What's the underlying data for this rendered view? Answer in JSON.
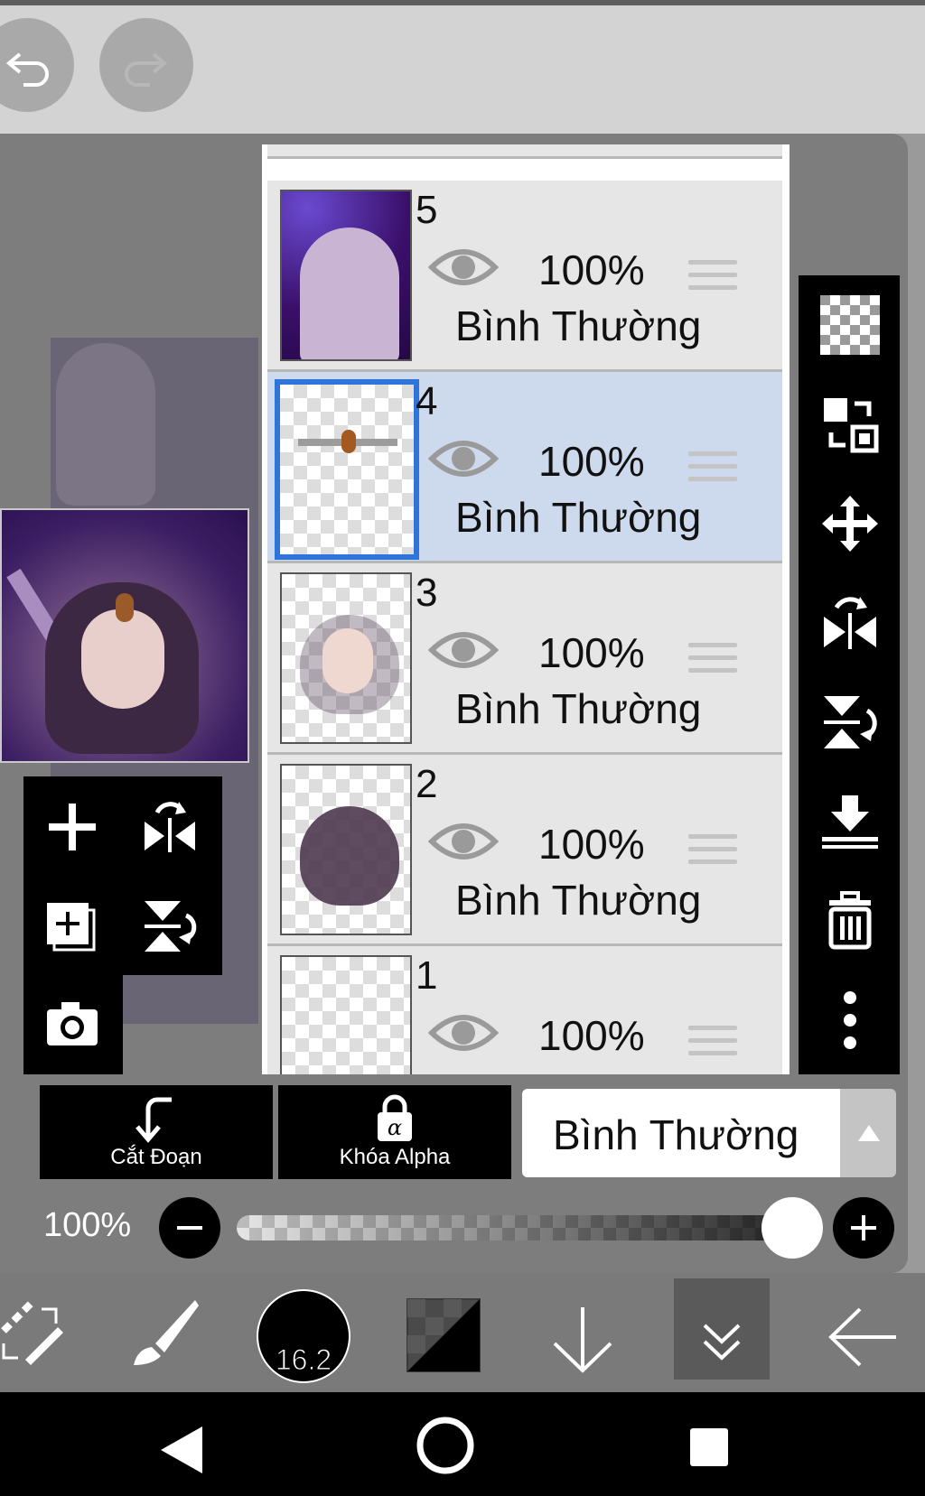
{
  "top_bar": {
    "undo_icon": "undo-icon",
    "redo_icon": "redo-icon"
  },
  "layers": [
    {
      "number": "5",
      "opacity": "100%",
      "blend_mode": "Bình Thường",
      "visible": true,
      "selected": false
    },
    {
      "number": "4",
      "opacity": "100%",
      "blend_mode": "Bình Thường",
      "visible": true,
      "selected": true
    },
    {
      "number": "3",
      "opacity": "100%",
      "blend_mode": "Bình Thường",
      "visible": true,
      "selected": false
    },
    {
      "number": "2",
      "opacity": "100%",
      "blend_mode": "Bình Thường",
      "visible": true,
      "selected": false
    },
    {
      "number": "1",
      "opacity": "100%",
      "blend_mode": "",
      "visible": true,
      "selected": false
    }
  ],
  "layer_actions": {
    "clip_label": "Cắt Đoạn",
    "alpha_lock_label": "Khóa Alpha",
    "blend_mode_value": "Bình Thường"
  },
  "opacity_control": {
    "value_label": "100%",
    "value": 1.0
  },
  "toolbar": {
    "brush_size": "16.2"
  },
  "colors": {
    "selected_layer": "#cdd9ec",
    "selection_border": "#2f74d8",
    "panel_black": "#000000"
  }
}
